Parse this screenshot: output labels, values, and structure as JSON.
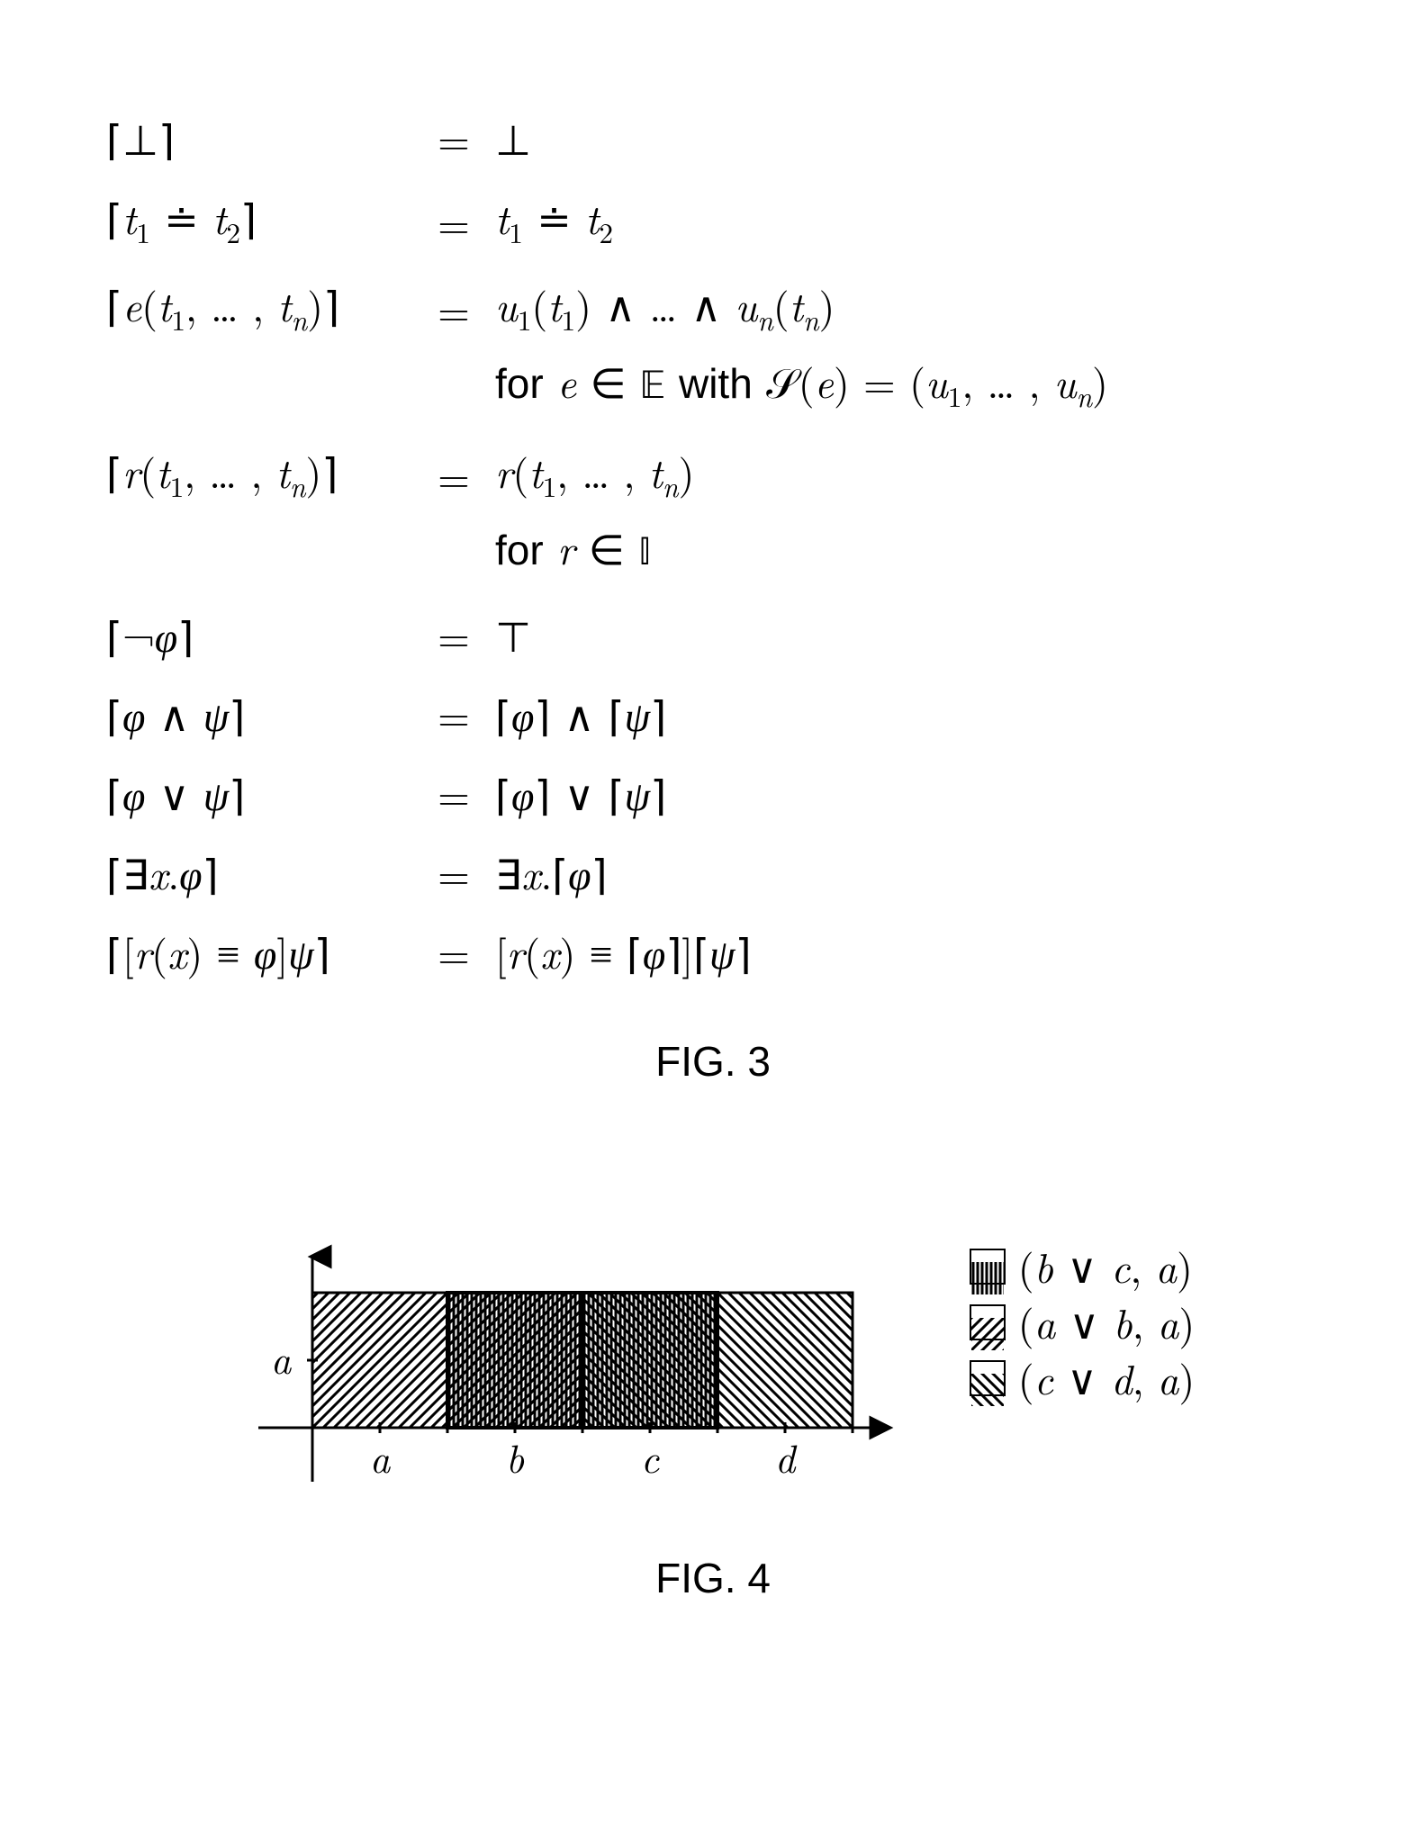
{
  "fig3": {
    "caption": "FIG. 3",
    "rows": [
      {
        "lhs": "⌈⊥⌉",
        "eq": "=",
        "rhs": "⊥"
      },
      {
        "lhs": "⌈t₁ ≐ t₂⌉",
        "eq": "=",
        "rhs": "t₁ ≐ t₂"
      },
      {
        "lhs": "⌈e(t₁, … , tₙ)⌉",
        "eq": "=",
        "rhs": "u₁(t₁) ∧ … ∧ uₙ(tₙ)"
      },
      {
        "lhs": "",
        "eq": "",
        "rhs": "for e ∈ 𝔼 with 𝒮(e) = (u₁, … , uₙ)",
        "side": true
      },
      {
        "lhs": "⌈r(t₁, … , tₙ)⌉",
        "eq": "=",
        "rhs": "r(t₁, … , tₙ)"
      },
      {
        "lhs": "",
        "eq": "",
        "rhs": "for r ∈ 𝕀",
        "side": true
      },
      {
        "lhs": "⌈¬φ⌉",
        "eq": "=",
        "rhs": "⊤"
      },
      {
        "lhs": "⌈φ ∧ ψ⌉",
        "eq": "=",
        "rhs": "⌈φ⌉ ∧ ⌈ψ⌉"
      },
      {
        "lhs": "⌈φ ∨ ψ⌉",
        "eq": "=",
        "rhs": "⌈φ⌉ ∨ ⌈ψ⌉"
      },
      {
        "lhs": "⌈∃x.φ⌉",
        "eq": "=",
        "rhs": "∃x.⌈φ⌉"
      },
      {
        "lhs": "⌈[r(x⃗) ≡ φ]ψ⌉",
        "eq": "=",
        "rhs": "[r(x⃗) ≡ ⌈φ⌉]⌈ψ⌉"
      }
    ]
  },
  "fig4": {
    "caption": "FIG. 4",
    "y_label": "a",
    "x_ticks": [
      "a",
      "b",
      "c",
      "d"
    ],
    "legend": [
      {
        "icon": "vert",
        "label": "(b ∨ c, a)"
      },
      {
        "icon": "nwse",
        "label": "(a ∨ b, a)"
      },
      {
        "icon": "nesw",
        "label": "(c ∨ d, a)"
      }
    ]
  },
  "chart_data": {
    "type": "area",
    "title": "",
    "xlabel": "",
    "ylabel": "",
    "x_ticks": [
      "a",
      "b",
      "c",
      "d"
    ],
    "y_ticks": [
      "a"
    ],
    "xlim": [
      0,
      4
    ],
    "ylim": [
      0,
      1
    ],
    "series": [
      {
        "name": "(b ∨ c, a)",
        "x_range": [
          1,
          3
        ],
        "y_range": [
          0,
          1
        ]
      },
      {
        "name": "(a ∨ b, a)",
        "x_range": [
          0,
          2
        ],
        "y_range": [
          0,
          1
        ]
      },
      {
        "name": "(c ∨ d, a)",
        "x_range": [
          2,
          4
        ],
        "y_range": [
          0,
          1
        ]
      }
    ]
  }
}
